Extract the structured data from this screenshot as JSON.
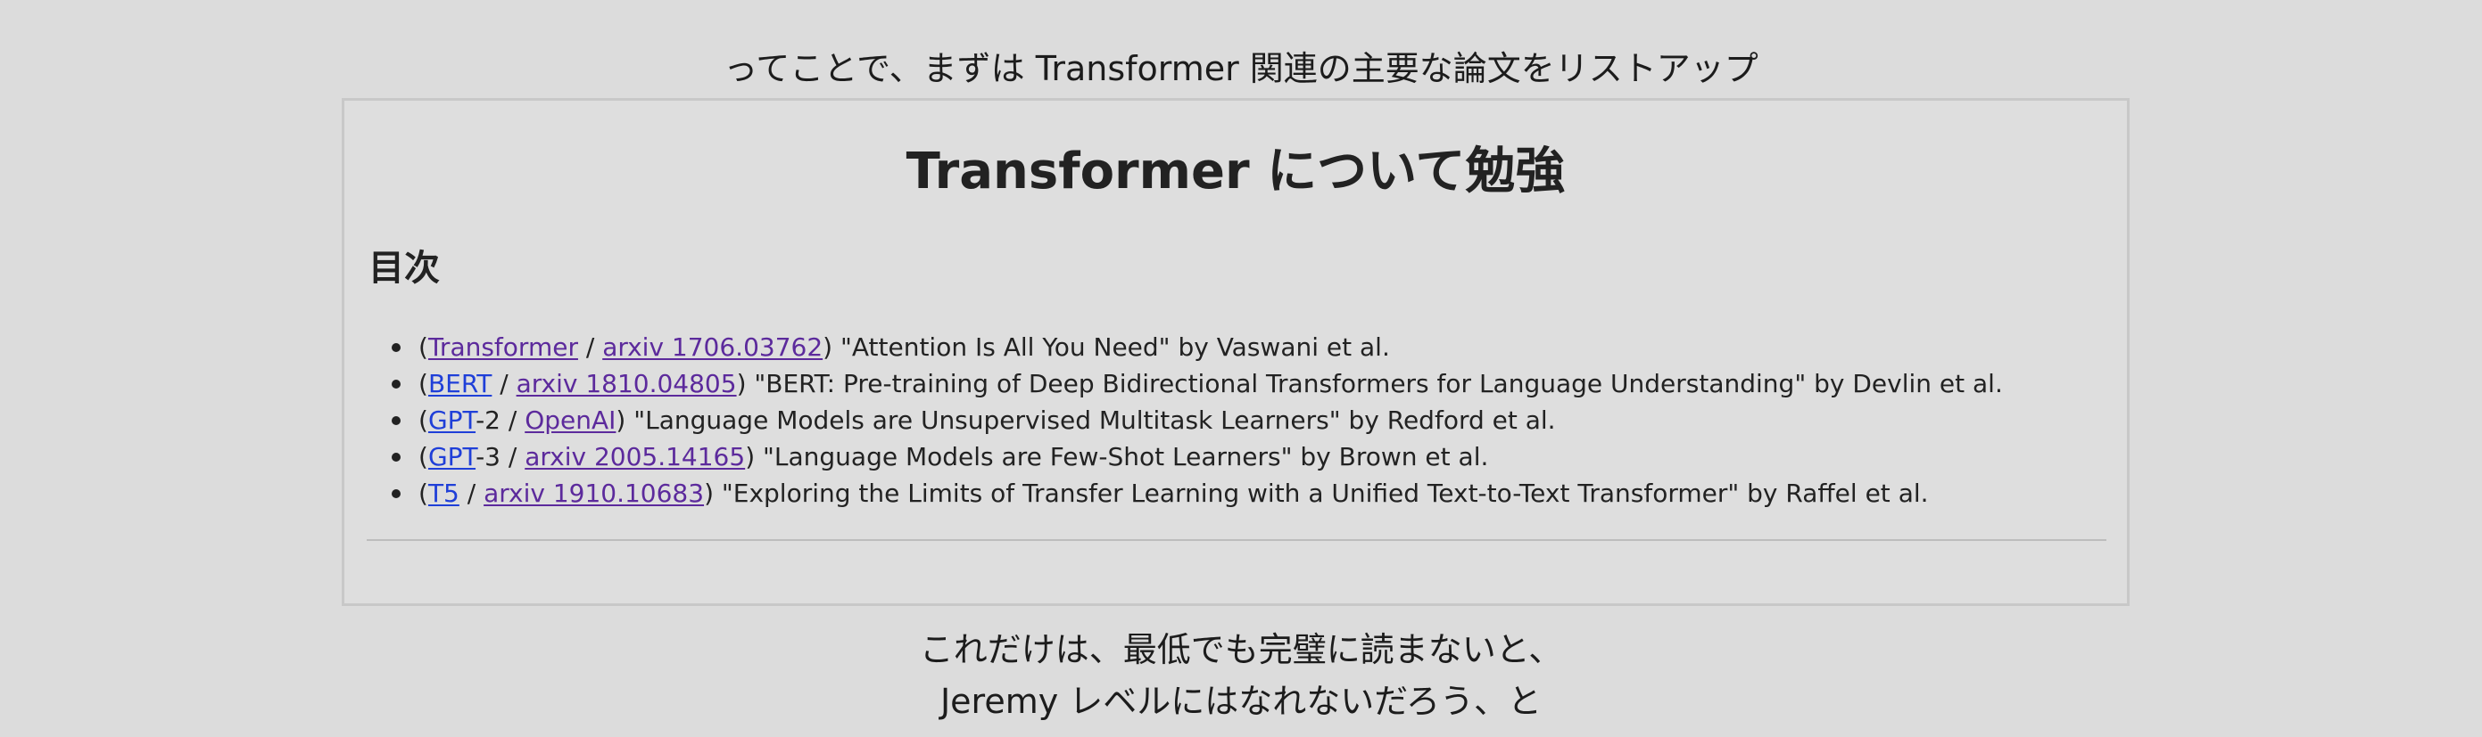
{
  "captions": {
    "top": "ってことで、まずは Transformer 関連の主要な論文をリストアップ",
    "bottom_line1": "これだけは、最低でも完璧に読まないと、",
    "bottom_line2": "Jeremy レベルにはなれないだろう、と"
  },
  "page": {
    "title": "Transformer について勉強",
    "toc_heading": "目次"
  },
  "papers": [
    {
      "open": "(",
      "link1": "Transformer",
      "sep": " / ",
      "link2": "arxiv 1706.03762",
      "rest": ") \"Attention Is All You Need\" by Vaswani et al."
    },
    {
      "open": "(",
      "link1": "BERT",
      "sep": " / ",
      "link2": "arxiv 1810.04805",
      "rest": ") \"BERT: Pre-training of Deep Bidirectional Transformers for Language Understanding\" by Devlin et al."
    },
    {
      "open": "(",
      "link1": "GPT",
      "sep": "-2 / ",
      "link2": "OpenAI",
      "rest": ") \"Language Models are Unsupervised Multitask Learners\" by Redford et al."
    },
    {
      "open": "(",
      "link1": "GPT",
      "sep": "-3 / ",
      "link2": "arxiv 2005.14165",
      "rest": ") \"Language Models are Few-Shot Learners\" by Brown et al."
    },
    {
      "open": "(",
      "link1": "T5",
      "sep": " / ",
      "link2": "arxiv 1910.10683",
      "rest": ") \"Exploring the Limits of Transfer Learning with a Unified Text-to-Text Transformer\" by Raffel et al."
    }
  ],
  "colors": {
    "background": "#dcdcdc",
    "visited_link": "#5c2a9c",
    "unvisited_link": "#1f3fd8"
  }
}
